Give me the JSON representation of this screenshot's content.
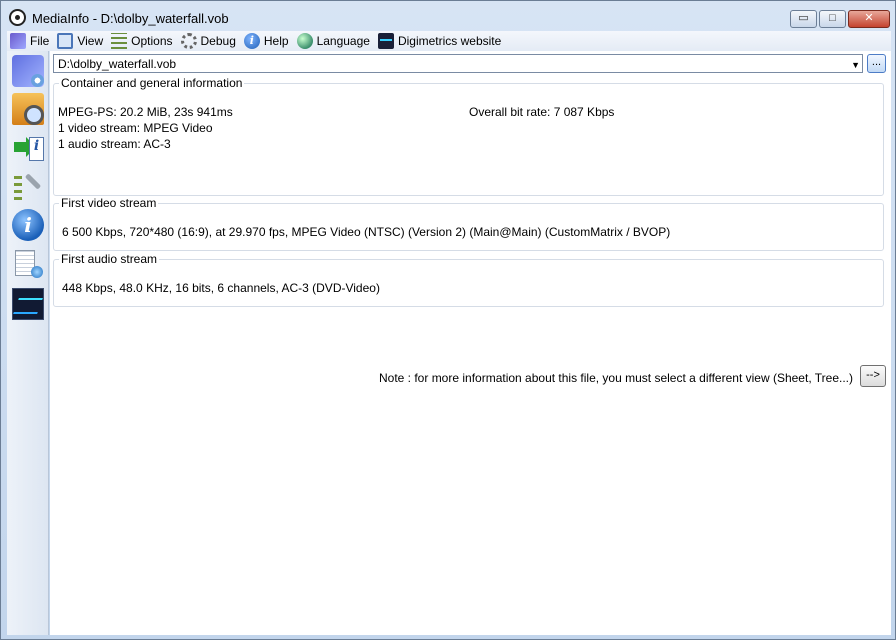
{
  "window": {
    "title": "MediaInfo - D:\\dolby_waterfall.vob",
    "buttons": {
      "minimize": "▭",
      "maximize": "□",
      "close": "✕"
    }
  },
  "menu": {
    "items": [
      {
        "label": "File",
        "icon": "file-icon"
      },
      {
        "label": "View",
        "icon": "view-icon"
      },
      {
        "label": "Options",
        "icon": "options-icon"
      },
      {
        "label": "Debug",
        "icon": "debug-icon"
      },
      {
        "label": "Help",
        "icon": "help-icon"
      },
      {
        "label": "Language",
        "icon": "language-icon"
      },
      {
        "label": "Digimetrics website",
        "icon": "digimetrics-icon"
      }
    ]
  },
  "toolbar": {
    "about_glyph": "i",
    "export_glyph": "i"
  },
  "file_select": {
    "value": "D:\\dolby_waterfall.vob",
    "arrow": "▼",
    "browse_label": "..."
  },
  "container": {
    "legend": "Container and general information",
    "format": "MPEG-PS: 20.2 MiB, 23s 941ms",
    "bitrate": "Overall bit rate: 7 087 Kbps",
    "video_count": "1 video stream: MPEG Video",
    "audio_count": "1 audio stream: AC-3"
  },
  "video": {
    "legend": "First video stream",
    "details": "6 500 Kbps, 720*480 (16:9), at 29.970 fps, MPEG Video (NTSC) (Version 2) (Main@Main) (CustomMatrix / BVOP)"
  },
  "audio": {
    "legend": "First audio stream",
    "details": "448 Kbps, 48.0 KHz, 16 bits, 6 channels, AC-3 (DVD-Video)"
  },
  "note": {
    "text": "Note : for more information about this file, you must select a different view (Sheet, Tree...)",
    "button_label": "-->"
  }
}
